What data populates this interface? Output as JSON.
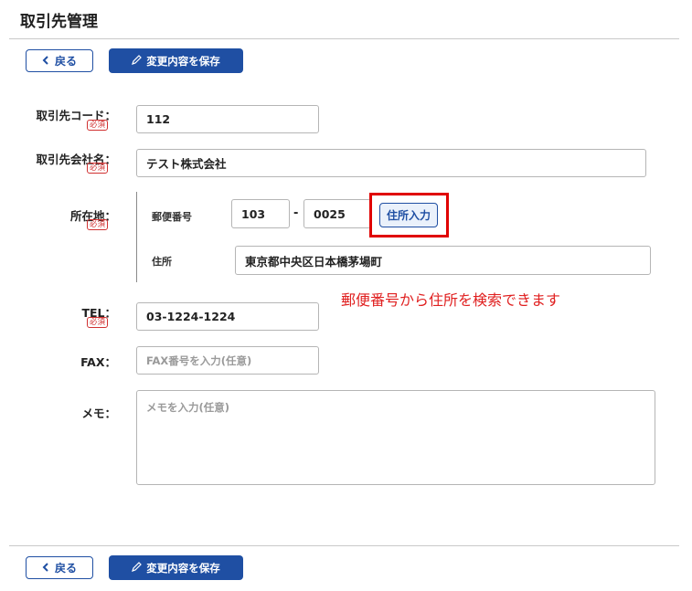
{
  "page": {
    "title": "取引先管理"
  },
  "toolbar": {
    "back_label": "戻る",
    "save_label": "変更内容を保存"
  },
  "form": {
    "required_badge": "必須",
    "code": {
      "label": "取引先コード：",
      "value": "112"
    },
    "company": {
      "label": "取引先会社名：",
      "value": "テスト株式会社"
    },
    "location": {
      "label": "所在地：",
      "postal_label": "郵便番号",
      "postal_first": "103",
      "postal_sep": "-",
      "postal_second": "0025",
      "lookup_button": "住所入力",
      "address_label": "住所",
      "address_value": "東京都中央区日本橋茅場町"
    },
    "tel": {
      "label": "TEL：",
      "value": "03-1224-1224"
    },
    "fax": {
      "label": "FAX：",
      "placeholder": "FAX番号を入力(任意)"
    },
    "memo": {
      "label": "メモ：",
      "placeholder": "メモを入力(任意)"
    }
  },
  "annotation": {
    "text": "郵便番号から住所を検索できます",
    "color": "#e02020"
  },
  "colors": {
    "primary": "#1f4fa3",
    "highlight": "#e00000",
    "required": "#d03030"
  }
}
